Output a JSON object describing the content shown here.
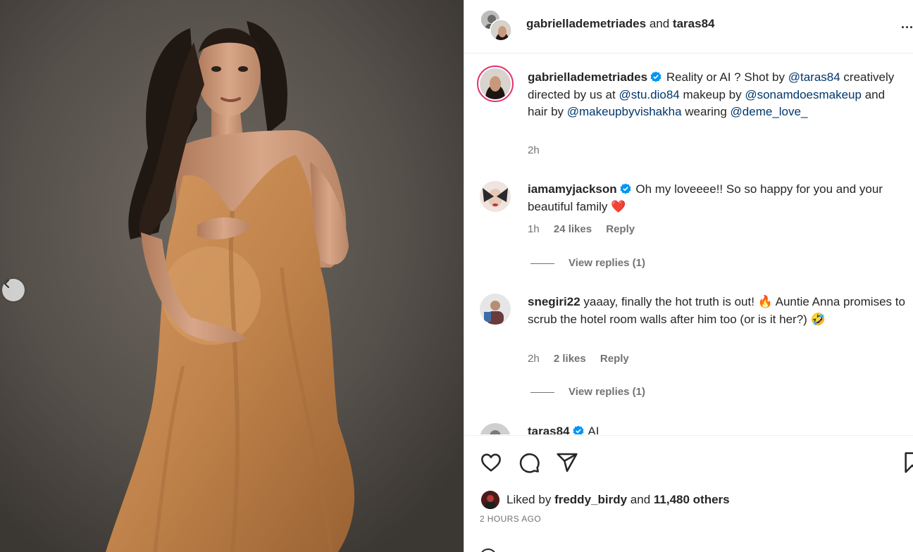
{
  "header": {
    "user1": "gabriellademetriades",
    "joiner": "and",
    "user2": "taras84",
    "more": "..."
  },
  "caption": {
    "username": "gabriellademetriades",
    "text1": "Reality or AI ? Shot by ",
    "mention1": "@taras84",
    "text2": " creatively directed by us at ",
    "mention2": "@stu.dio84",
    "text3": " makeup by ",
    "mention3": "@sonamdoesmakeup",
    "text4": " and hair by ",
    "mention4": "@makeupbyvishakha",
    "text5": " wearing ",
    "mention5": "@deme_love_",
    "time": "2h"
  },
  "comments": [
    {
      "username": "iamamyjackson",
      "verified": true,
      "text": "Oh my loveeee!! So so happy for you and your beautiful family",
      "emoji": "❤️",
      "time": "1h",
      "likes": "24 likes",
      "reply": "Reply",
      "view_replies": "View replies (1)"
    },
    {
      "username": "snegiri22",
      "verified": false,
      "text_a": "yaaay, finally the hot truth is out!",
      "emoji_a": "🔥",
      "text_b": "Auntie Anna promises to scrub the hotel room walls after him too (or is it her?)",
      "emoji_b": "🤣",
      "time": "2h",
      "likes": "2 likes",
      "reply": "Reply",
      "view_replies": "View replies (1)"
    },
    {
      "username": "taras84",
      "verified": true,
      "text": "AI"
    }
  ],
  "actions": {
    "like_icon": "heart-icon",
    "comment_icon": "comment-icon",
    "share_icon": "send-icon",
    "save_icon": "bookmark-icon"
  },
  "likes": {
    "prefix": "Liked by",
    "user": "freddy_birdy",
    "joiner": "and",
    "others": "11,480 others"
  },
  "time_ago": "2 HOURS AGO",
  "colors": {
    "link": "#00376b",
    "verified": "#0095f6",
    "muted": "#737373",
    "story_ring": "#e1306c",
    "dress": "#c4874f"
  }
}
